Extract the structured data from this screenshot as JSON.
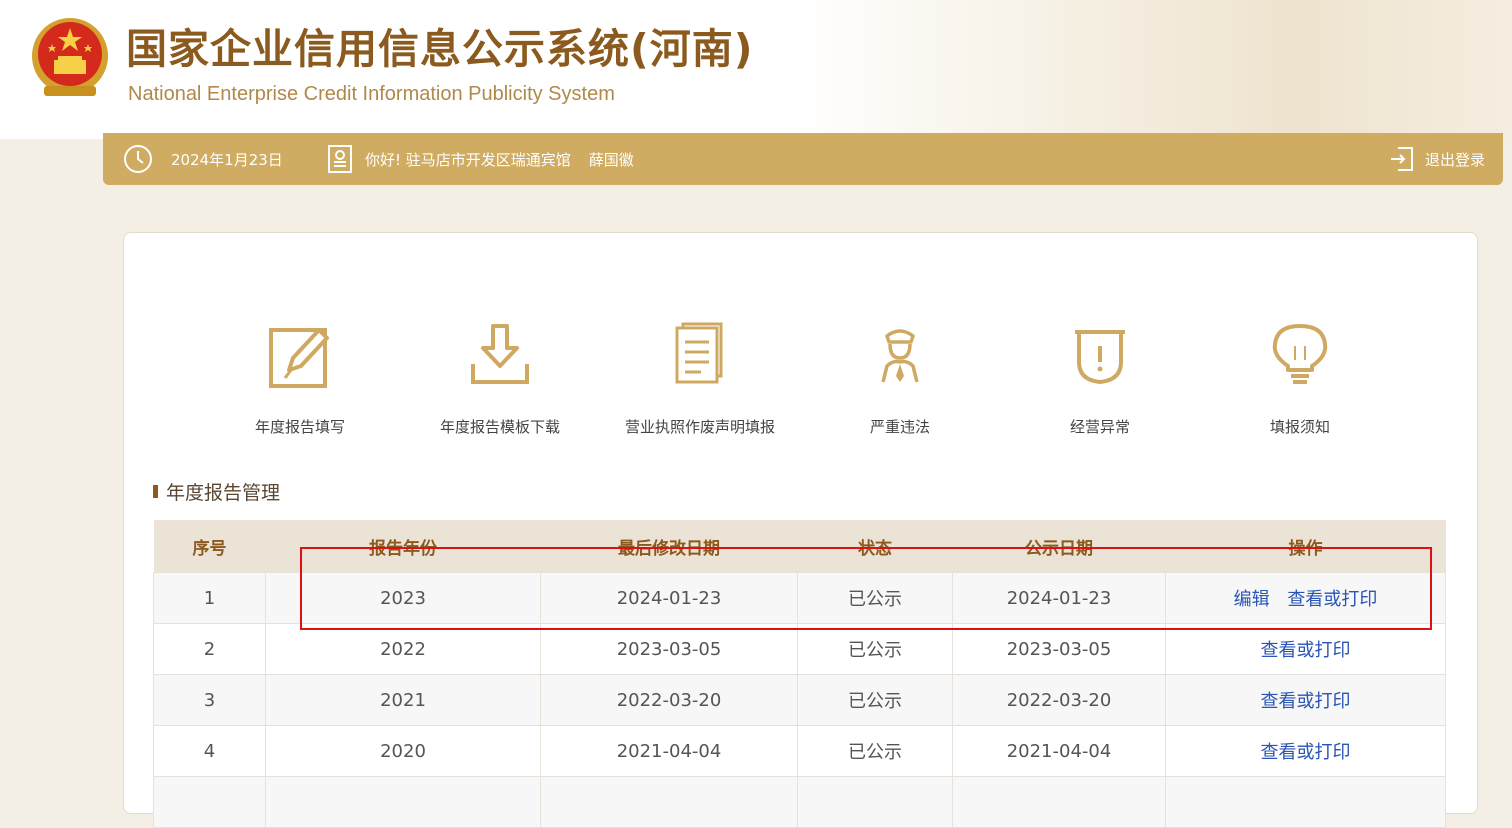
{
  "header": {
    "title": "国家企业信用信息公示系统(河南)",
    "subtitle": "National Enterprise Credit Information Publicity System"
  },
  "userbar": {
    "date": "2024年1月23日",
    "greeting": "你好! 驻马店市开发区瑞通宾馆",
    "user_name": "薛国徽",
    "logout_label": "退出登录"
  },
  "quick_actions": [
    {
      "label": "年度报告填写",
      "icon": "edit-icon"
    },
    {
      "label": "年度报告模板下载",
      "icon": "download-icon"
    },
    {
      "label": "营业执照作废声明填报",
      "icon": "document-icon"
    },
    {
      "label": "严重违法",
      "icon": "officer-icon"
    },
    {
      "label": "经营异常",
      "icon": "alert-icon"
    },
    {
      "label": "填报须知",
      "icon": "lightbulb-icon"
    }
  ],
  "section": {
    "title": "年度报告管理"
  },
  "table": {
    "headers": [
      "序号",
      "报告年份",
      "最后修改日期",
      "状态",
      "公示日期",
      "操作"
    ],
    "rows": [
      {
        "no": "1",
        "year": "2023",
        "modified": "2024-01-23",
        "status": "已公示",
        "published": "2024-01-23",
        "actions": [
          "编辑",
          "查看或打印"
        ]
      },
      {
        "no": "2",
        "year": "2022",
        "modified": "2023-03-05",
        "status": "已公示",
        "published": "2023-03-05",
        "actions": [
          "查看或打印"
        ]
      },
      {
        "no": "3",
        "year": "2021",
        "modified": "2022-03-20",
        "status": "已公示",
        "published": "2022-03-20",
        "actions": [
          "查看或打印"
        ]
      },
      {
        "no": "4",
        "year": "2020",
        "modified": "2021-04-04",
        "status": "已公示",
        "published": "2021-04-04",
        "actions": [
          "查看或打印"
        ]
      }
    ]
  },
  "colors": {
    "brand_brown": "#8b5a1e",
    "bar_gold": "#d0ab62",
    "icon_gold": "#cfa862",
    "link_blue": "#2a55b5",
    "highlight_red": "#dd1111"
  }
}
